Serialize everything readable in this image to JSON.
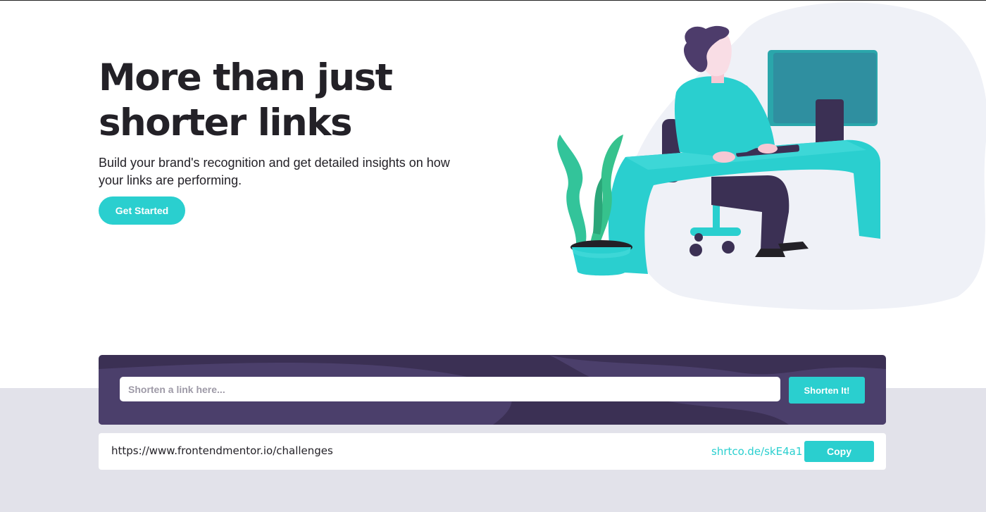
{
  "hero": {
    "title_line1": "More than just",
    "title_line2": "shorter links",
    "subtitle": "Build your brand's recognition and get detailed insights on how your links are performing.",
    "cta_label": "Get Started"
  },
  "shortener": {
    "placeholder": "Shorten a link here...",
    "button_label": "Shorten It!"
  },
  "result": {
    "original_url": "https://www.frontendmentor.io/challenges",
    "short_url": "shrtco.de/skE4a1",
    "copy_label": "Copy"
  },
  "colors": {
    "accent": "#2acfcf",
    "dark_violet": "#3b3054",
    "heading": "#232127",
    "light_gray": "#e2e2ea"
  },
  "icons": {
    "illustration": "person-working-illustration"
  }
}
